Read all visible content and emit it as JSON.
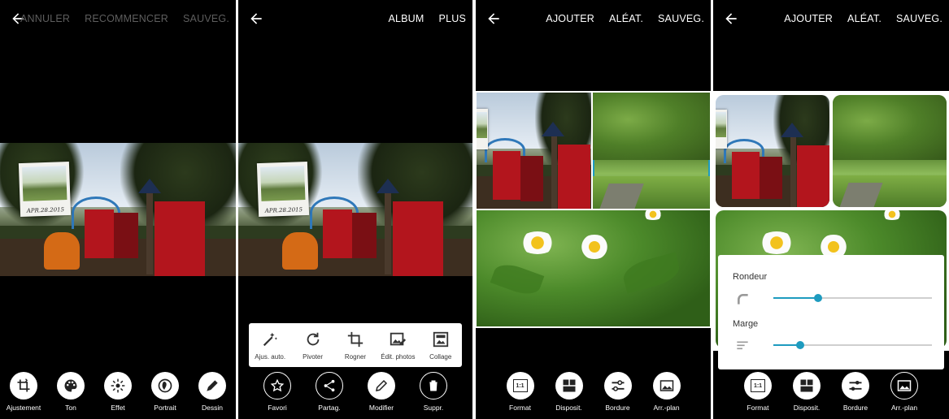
{
  "colors": {
    "accent": "#1e9bbf",
    "background": "#000000",
    "dim_text": "#5e5e5e"
  },
  "panel1": {
    "topbar": {
      "cancel": "ANNULER",
      "restart": "RECOMMENCER",
      "save": "SAUVEG."
    },
    "photo_caption": "APR.28.2015",
    "tools": [
      {
        "label": "Ajustement",
        "icon": "crop-rotate-icon"
      },
      {
        "label": "Ton",
        "icon": "palette-icon"
      },
      {
        "label": "Effet",
        "icon": "sparkle-effect-icon"
      },
      {
        "label": "Portrait",
        "icon": "portrait-icon"
      },
      {
        "label": "Dessin",
        "icon": "pen-draw-icon"
      }
    ]
  },
  "panel2": {
    "topbar": {
      "album": "ALBUM",
      "more": "PLUS"
    },
    "photo_caption": "APR.28.2015",
    "popup": [
      {
        "label": "Ajus. auto.",
        "icon": "magic-wand-icon"
      },
      {
        "label": "Pivoter",
        "icon": "rotate-icon"
      },
      {
        "label": "Rogner",
        "icon": "crop-icon"
      },
      {
        "label": "Édit. photos",
        "icon": "photo-edit-icon"
      },
      {
        "label": "Collage",
        "icon": "collage-icon"
      }
    ],
    "tools": [
      {
        "label": "Favori",
        "icon": "star-icon"
      },
      {
        "label": "Partag.",
        "icon": "share-icon"
      },
      {
        "label": "Modifier",
        "icon": "pencil-icon",
        "active": true
      },
      {
        "label": "Suppr.",
        "icon": "trash-icon"
      }
    ]
  },
  "panel3": {
    "topbar": {
      "add": "AJOUTER",
      "random": "ALÉAT.",
      "save": "SAUVEG."
    },
    "tools": [
      {
        "label": "Format",
        "icon": "format-ratio-icon"
      },
      {
        "label": "Disposit.",
        "icon": "layout-icon"
      },
      {
        "label": "Bordure",
        "icon": "border-sliders-icon"
      },
      {
        "label": "Arr.-plan",
        "icon": "background-image-icon"
      }
    ],
    "format_badge": "1:1"
  },
  "panel4": {
    "topbar": {
      "add": "AJOUTER",
      "random": "ALÉAT.",
      "save": "SAUVEG."
    },
    "border_panel": {
      "roundness_label": "Rondeur",
      "roundness_value": 0.28,
      "margin_label": "Marge",
      "margin_value": 0.17
    },
    "tools": [
      {
        "label": "Format",
        "icon": "format-ratio-icon"
      },
      {
        "label": "Disposit.",
        "icon": "layout-icon"
      },
      {
        "label": "Bordure",
        "icon": "border-sliders-icon",
        "active": true
      },
      {
        "label": "Arr.-plan",
        "icon": "background-image-icon"
      }
    ],
    "format_badge": "1:1"
  }
}
